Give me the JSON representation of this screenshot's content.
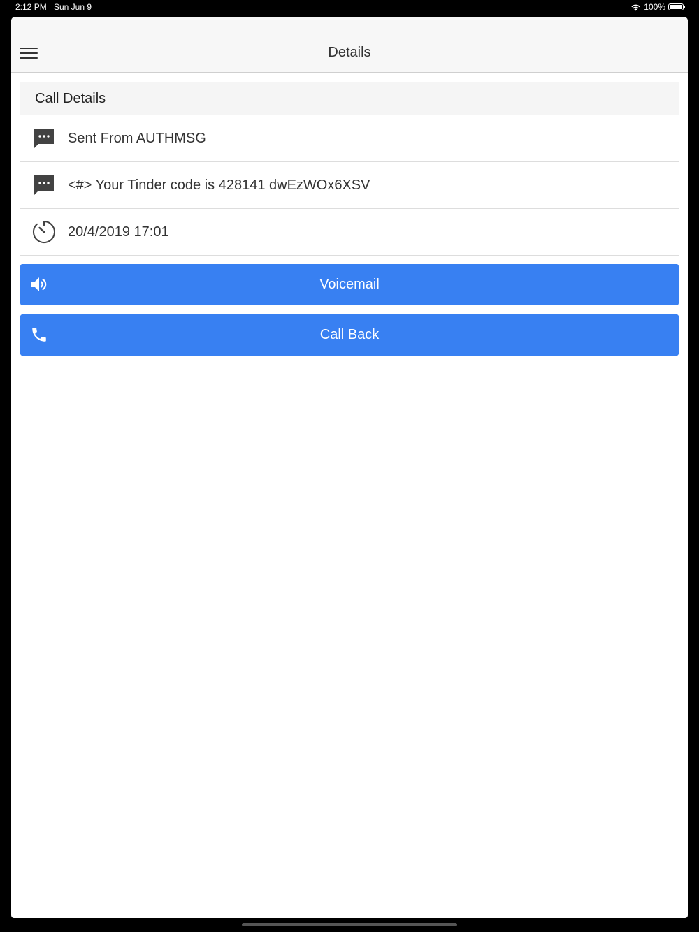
{
  "status_bar": {
    "time": "2:12 PM",
    "date": "Sun Jun 9",
    "battery": "100%",
    "icons": [
      "wifi-icon",
      "battery-icon"
    ]
  },
  "nav": {
    "title": "Details",
    "menu_icon": "hamburger-menu-icon"
  },
  "card": {
    "header": "Call Details",
    "rows": [
      {
        "icon": "message-icon",
        "text": "Sent From AUTHMSG"
      },
      {
        "icon": "message-icon",
        "text": "<#> Your Tinder code is 428141 dwEzWOx6XSV"
      },
      {
        "icon": "timer-icon",
        "text": "20/4/2019 17:01"
      }
    ]
  },
  "buttons": {
    "voicemail": {
      "label": "Voicemail",
      "icon": "speaker-icon"
    },
    "call_back": {
      "label": "Call Back",
      "icon": "phone-icon"
    }
  },
  "colors": {
    "accent": "#3880f2",
    "nav_background": "#f7f7f7",
    "header_background": "#f5f5f5",
    "text": "#333333"
  }
}
